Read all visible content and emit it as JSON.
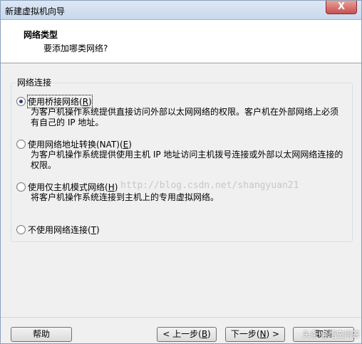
{
  "window": {
    "title": "新建虚拟机向导",
    "close_symbol": "X"
  },
  "header": {
    "title": "网络类型",
    "subtitle": "要添加哪类网络?"
  },
  "group": {
    "label": "网络连接"
  },
  "options": [
    {
      "label_text": "使用桥接网络(",
      "mnemonic": "R",
      "label_end": ")",
      "checked": true,
      "desc": "为客户机操作系统提供直接访问外部以太网网络的权限。客户机在外部网络上必须有自己的 IP 地址。"
    },
    {
      "label_text": "使用网络地址转换(NAT)(",
      "mnemonic": "E",
      "label_end": ")",
      "checked": false,
      "desc": "为客户机操作系统提供使用主机 IP 地址访问主机拨号连接或外部以太网网络连接的权限。"
    },
    {
      "label_text": "使用仅主机模式网络(",
      "mnemonic": "H",
      "label_end": ")",
      "checked": false,
      "desc": "将客户机操作系统连接到主机上的专用虚拟网络。"
    },
    {
      "label_text": "不使用网络连接(",
      "mnemonic": "T",
      "label_end": ")",
      "checked": false,
      "desc": ""
    }
  ],
  "watermark": "http://blog.csdn.net/shangyuan21",
  "buttons": {
    "help": "帮助",
    "back_text": "< 上一步(",
    "back_key": "B",
    "back_end": ")",
    "next_text": "下一步(",
    "next_key": "N",
    "next_end": ") >",
    "cancel": "取消"
  },
  "badge": "头条 @悟空问答"
}
